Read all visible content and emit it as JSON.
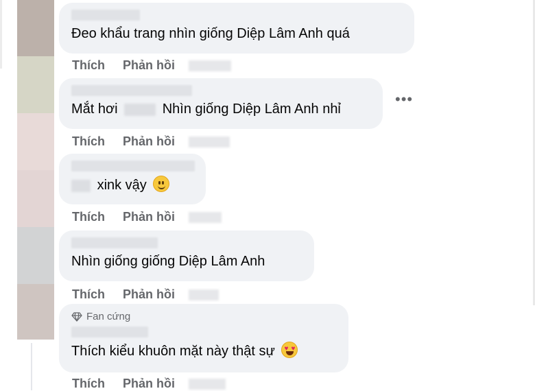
{
  "colors": {
    "bubble_bg": "#f0f2f5",
    "action_text": "#65676b",
    "body_text": "#050505"
  },
  "actions": {
    "like": "Thích",
    "reply": "Phản hồi"
  },
  "comments": [
    {
      "text": "Đeo khẩu trang nhìn giống Diệp Lâm Anh quá"
    },
    {
      "text_before": "Mắt hơi",
      "text_after": "Nhìn giống Diệp Lâm Anh nhỉ"
    },
    {
      "text": "xink vậy",
      "emoji": "slightly-smiling-face-icon"
    },
    {
      "text": "Nhìn giống giống Diệp Lâm Anh"
    },
    {
      "badge": "Fan cứng",
      "text": "Thích kiểu khuôn mặt này thật sự",
      "emoji": "heart-eyes-face-icon"
    }
  ],
  "more_menu": "•••"
}
